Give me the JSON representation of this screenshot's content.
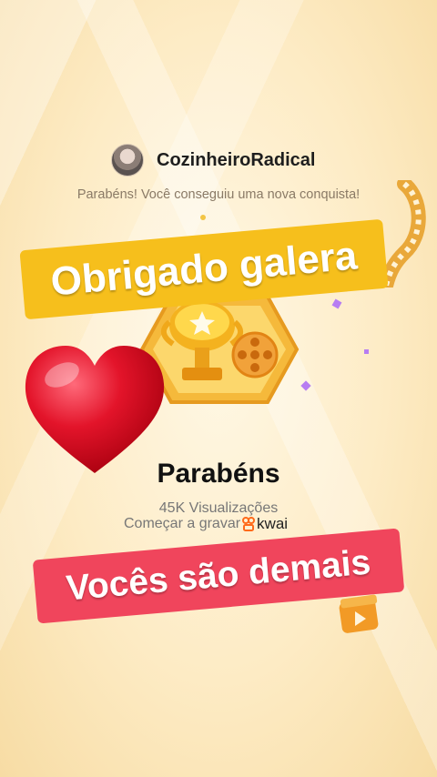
{
  "profile": {
    "username": "CozinheiroRadical"
  },
  "achievement": {
    "message": "Parabéns! Você conseguiu uma nova conquista!",
    "title": "Parabéns",
    "views": "45K Visualizações",
    "record_label": "Começar a gravar",
    "brand": "kwai"
  },
  "overlays": {
    "top_banner": "Obrigado galera",
    "bottom_banner": "Vocês são demais"
  },
  "colors": {
    "top_banner": "#f6bf1c",
    "bottom_banner": "#f0455c",
    "heart": "#d9101f"
  },
  "icons": [
    "heart-icon",
    "trophy-icon",
    "film-reel-icon",
    "play-icon",
    "kwai-logo-icon"
  ]
}
